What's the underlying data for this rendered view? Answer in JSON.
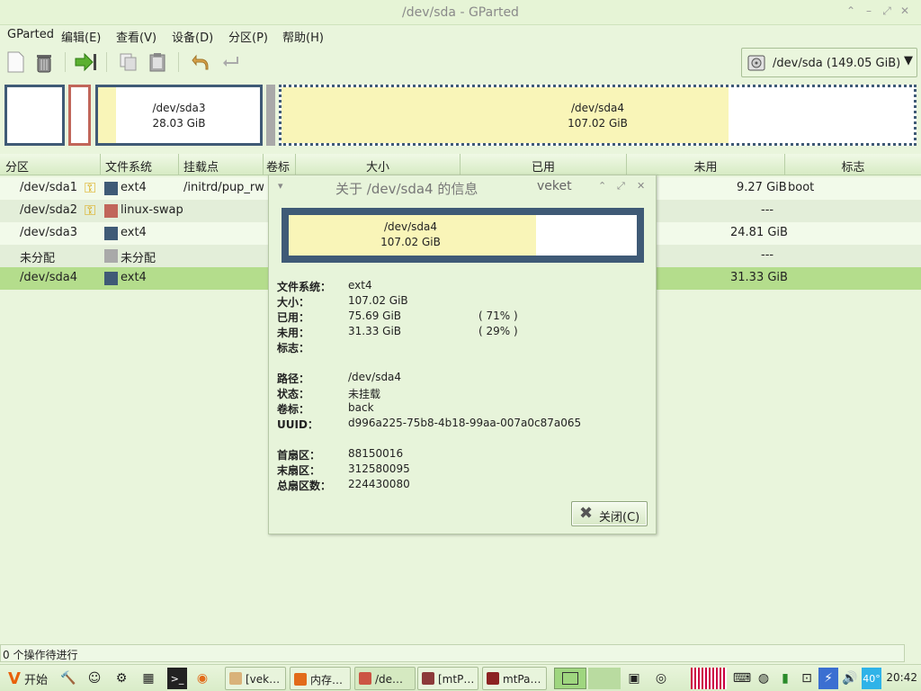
{
  "window": {
    "title": "/dev/sda - GParted"
  },
  "menu": [
    "GParted",
    "编辑(E)",
    "查看(V)",
    "设备(D)",
    "分区(P)",
    "帮助(H)"
  ],
  "device_selector": {
    "label": "/dev/sda  (149.05 GiB)"
  },
  "graph": {
    "sda3": {
      "name": "/dev/sda3",
      "size": "28.03 GiB"
    },
    "sda4": {
      "name": "/dev/sda4",
      "size": "107.02 GiB"
    }
  },
  "table": {
    "headers": [
      "分区",
      "文件系统",
      "挂载点",
      "卷标",
      "大小",
      "已用",
      "未用",
      "标志"
    ],
    "rows": [
      {
        "partition": "/dev/sda1",
        "fs": "ext4",
        "mount": "/initrd/pup_rw",
        "unused": "9.27 GiB",
        "flags": "boot",
        "fs_color": "#3f5a76",
        "key": true
      },
      {
        "partition": "/dev/sda2",
        "fs": "linux-swap",
        "mount": "",
        "unused": "---",
        "flags": "",
        "fs_color": "#c1665a",
        "key": true
      },
      {
        "partition": "/dev/sda3",
        "fs": "ext4",
        "mount": "",
        "unused": "24.81 GiB",
        "flags": "",
        "fs_color": "#3f5a76",
        "key": false
      },
      {
        "partition": "未分配",
        "fs": "未分配",
        "mount": "",
        "unused": "---",
        "flags": "",
        "fs_color": "#a9a9a9",
        "key": false
      },
      {
        "partition": "/dev/sda4",
        "fs": "ext4",
        "mount": "",
        "unused": "31.33 GiB",
        "flags": "",
        "fs_color": "#3f5a76",
        "key": false
      }
    ]
  },
  "dialog": {
    "title": "关于 /dev/sda4 的信息",
    "user": "veket",
    "graph_name": "/dev/sda4",
    "graph_size": "107.02 GiB",
    "used_fraction": 0.71,
    "labels": {
      "fs": "文件系统：",
      "size": "大小：",
      "used": "已用：",
      "unused": "未用：",
      "flags": "标志：",
      "path": "路径：",
      "status": "状态：",
      "label": "卷标：",
      "uuid": "UUID：",
      "first": "首扇区：",
      "last": "末扇区：",
      "total": "总扇区数："
    },
    "values": {
      "fs": "ext4",
      "size": "107.02 GiB",
      "used": "75.69 GiB",
      "used_pct": "( 71% )",
      "unused": "31.33 GiB",
      "unused_pct": "( 29% )",
      "flags": "",
      "path": "/dev/sda4",
      "status": "未挂载",
      "label": "back",
      "uuid": "d996a225-75b8-4b18-99aa-007a0c87a065",
      "first": "88150016",
      "last": "312580095",
      "total": "224430080"
    },
    "close_label": "关闭(C)"
  },
  "status": "0 个操作待进行",
  "taskbar": {
    "start": "开始",
    "tasks": [
      "[vek…",
      "内存…",
      "/de…",
      "[mtP…",
      "mtPa…"
    ],
    "temp": "40°",
    "clock": "20:42"
  }
}
